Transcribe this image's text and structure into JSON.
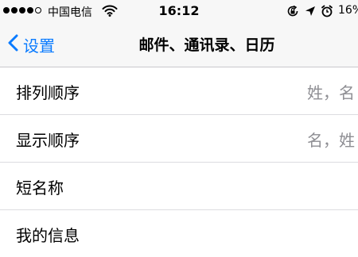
{
  "status_bar": {
    "carrier": "中国电信",
    "time": "16:12",
    "battery": "16%"
  },
  "nav": {
    "back_label": "设置",
    "title": "邮件、通讯录、日历"
  },
  "rows": [
    {
      "label": "排列顺序",
      "value": "姓，名"
    },
    {
      "label": "显示顺序",
      "value": "名，姓"
    },
    {
      "label": "短名称",
      "value": ""
    },
    {
      "label": "我的信息",
      "value": ""
    }
  ],
  "colors": {
    "accent": "#0a7bff",
    "secondary_text": "#8e8e93",
    "nav_background": "#f7f7f7"
  }
}
